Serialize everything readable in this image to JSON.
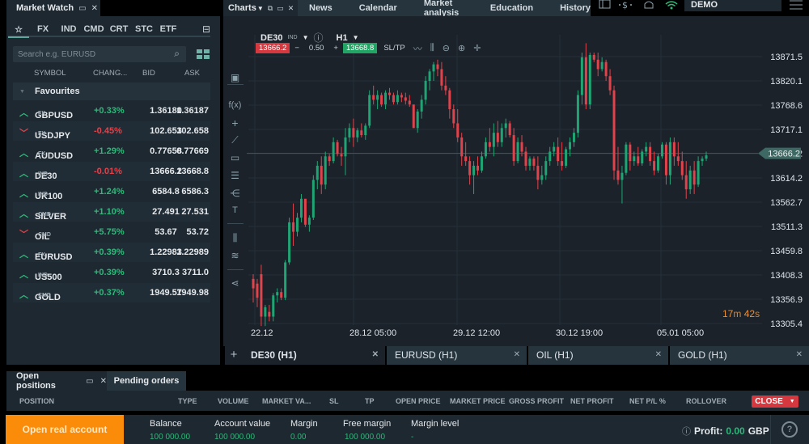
{
  "market_watch": {
    "title": "Market Watch",
    "tabs": [
      "☆",
      "FX",
      "IND",
      "CMD",
      "CRT",
      "STC",
      "ETF"
    ],
    "search_placeholder": "Search e.g. EURUSD",
    "columns": {
      "symbol": "SYMBOL",
      "change": "CHANG...",
      "bid": "BID",
      "ask": "ASK"
    },
    "group": "Favourites",
    "rows": [
      {
        "dir": "up",
        "symbol": "GBPUSD",
        "cls": "FX",
        "change": "+0.33%",
        "chg_dir": "up",
        "bid": "1.36180",
        "ask": "1.36187"
      },
      {
        "dir": "down",
        "symbol": "USDJPY",
        "cls": "FX",
        "change": "-0.45%",
        "chg_dir": "down",
        "bid": "102.653",
        "ask": "102.658"
      },
      {
        "dir": "up",
        "symbol": "AUDUSD",
        "cls": "FX",
        "change": "+1.29%",
        "chg_dir": "up",
        "bid": "0.77658",
        "ask": "0.77669"
      },
      {
        "dir": "up",
        "symbol": "DE30",
        "cls": "IND",
        "change": "-0.01%",
        "chg_dir": "down",
        "bid": "13666.2",
        "ask": "13668.8"
      },
      {
        "dir": "up",
        "symbol": "UK100",
        "cls": "IND",
        "change": "+1.24%",
        "chg_dir": "up",
        "bid": "6584.8",
        "ask": "6586.3"
      },
      {
        "dir": "up",
        "symbol": "SILVER",
        "cls": "CMD",
        "change": "+1.10%",
        "chg_dir": "up",
        "bid": "27.491",
        "ask": "27.531"
      },
      {
        "dir": "down",
        "symbol": "OIL",
        "cls": "CMD",
        "change": "+5.75%",
        "chg_dir": "up",
        "bid": "53.67",
        "ask": "53.72"
      },
      {
        "dir": "up",
        "symbol": "EURUSD",
        "cls": "FX",
        "change": "+0.39%",
        "chg_dir": "up",
        "bid": "1.22983",
        "ask": "1.22989"
      },
      {
        "dir": "up",
        "symbol": "US500",
        "cls": "IND",
        "change": "+0.39%",
        "chg_dir": "up",
        "bid": "3710.3",
        "ask": "3711.0"
      },
      {
        "dir": "up",
        "symbol": "GOLD",
        "cls": "CMD",
        "change": "+0.37%",
        "chg_dir": "up",
        "bid": "1949.57",
        "ask": "1949.98"
      }
    ]
  },
  "nav": {
    "charts_label": "Charts",
    "items": [
      "News",
      "Calendar",
      "Market analysis",
      "Education",
      "History"
    ],
    "account_mode": "DEMO"
  },
  "chart": {
    "symbol": "DE30",
    "symbol_class": "IND",
    "timeframe": "H1",
    "sell_price": "13666.2",
    "volume": "0.50",
    "buy_price": "13668.8",
    "sltp_label": "SL/TP",
    "current_price_label": "13666.2",
    "countdown": {
      "min": "17",
      "min_unit": "m",
      "sec": "42",
      "sec_unit": "s"
    },
    "tabs": [
      {
        "label": "DE30 (H1)",
        "active": true
      },
      {
        "label": "EURUSD (H1)",
        "active": false
      },
      {
        "label": "OIL (H1)",
        "active": false
      },
      {
        "label": "GOLD (H1)",
        "active": false
      }
    ]
  },
  "chart_data": {
    "type": "candlestick",
    "title": "DE30 H1",
    "xlabel": "",
    "ylabel": "",
    "ylim": [
      13280,
      13900
    ],
    "y_ticks": [
      "13871.5",
      "13820.1",
      "13768.6",
      "13717.1",
      "13666.2",
      "13614.2",
      "13562.7",
      "13511.3",
      "13459.8",
      "13408.3",
      "13356.9",
      "13305.4"
    ],
    "x_ticks": [
      "22.12",
      "28.12 05:00",
      "29.12 12:00",
      "30.12 19:00",
      "05.01 05:00"
    ],
    "current_price": 13666.2,
    "ohlc": [
      [
        13400,
        13410,
        13350,
        13380
      ],
      [
        13390,
        13400,
        13340,
        13360
      ],
      [
        13410,
        13430,
        13300,
        13320
      ],
      [
        13320,
        13345,
        13300,
        13340
      ],
      [
        13330,
        13345,
        13310,
        13320
      ],
      [
        13320,
        13370,
        13310,
        13365
      ],
      [
        13365,
        13380,
        13350,
        13372
      ],
      [
        13372,
        13380,
        13355,
        13360
      ],
      [
        13360,
        13440,
        13355,
        13435
      ],
      [
        13435,
        13530,
        13430,
        13520
      ],
      [
        13520,
        13560,
        13470,
        13500
      ],
      [
        13500,
        13540,
        13490,
        13530
      ],
      [
        13530,
        13580,
        13520,
        13570
      ],
      [
        13570,
        13560,
        13510,
        13515
      ],
      [
        13515,
        13535,
        13500,
        13530
      ],
      [
        13530,
        13620,
        13525,
        13610
      ],
      [
        13610,
        13650,
        13590,
        13640
      ],
      [
        13640,
        13660,
        13580,
        13600
      ],
      [
        13600,
        13670,
        13590,
        13660
      ],
      [
        13660,
        13665,
        13640,
        13650
      ],
      [
        13650,
        13700,
        13645,
        13690
      ],
      [
        13690,
        13695,
        13660,
        13665
      ],
      [
        13665,
        13680,
        13640,
        13660
      ],
      [
        13660,
        13720,
        13620,
        13700
      ],
      [
        13700,
        13730,
        13690,
        13720
      ],
      [
        13720,
        13740,
        13680,
        13700
      ],
      [
        13700,
        13720,
        13690,
        13715
      ],
      [
        13715,
        13730,
        13700,
        13705
      ],
      [
        13705,
        13730,
        13695,
        13725
      ],
      [
        13725,
        13800,
        13720,
        13790
      ],
      [
        13790,
        13810,
        13770,
        13780
      ],
      [
        13780,
        13800,
        13760,
        13790
      ],
      [
        13790,
        13795,
        13765,
        13770
      ],
      [
        13770,
        13800,
        13760,
        13795
      ],
      [
        13795,
        13805,
        13780,
        13790
      ],
      [
        13790,
        13795,
        13770,
        13775
      ],
      [
        13775,
        13800,
        13770,
        13790
      ],
      [
        13790,
        13795,
        13775,
        13785
      ],
      [
        13785,
        13795,
        13770,
        13778
      ],
      [
        13778,
        13790,
        13765,
        13770
      ],
      [
        13770,
        13730,
        13720,
        13720
      ],
      [
        13720,
        13760,
        13710,
        13755
      ],
      [
        13755,
        13790,
        13740,
        13780
      ],
      [
        13780,
        13830,
        13770,
        13820
      ],
      [
        13820,
        13845,
        13800,
        13840
      ],
      [
        13840,
        13860,
        13820,
        13855
      ],
      [
        13855,
        13865,
        13830,
        13845
      ],
      [
        13845,
        13860,
        13800,
        13810
      ],
      [
        13810,
        13830,
        13790,
        13800
      ],
      [
        13800,
        13805,
        13740,
        13760
      ],
      [
        13760,
        13770,
        13720,
        13730
      ],
      [
        13730,
        13760,
        13690,
        13700
      ],
      [
        13700,
        13710,
        13640,
        13660
      ],
      [
        13660,
        13690,
        13640,
        13650
      ],
      [
        13650,
        13660,
        13600,
        13620
      ],
      [
        13620,
        13650,
        13580,
        13640
      ],
      [
        13640,
        13660,
        13620,
        13630
      ],
      [
        13630,
        13670,
        13625,
        13660
      ],
      [
        13660,
        13700,
        13655,
        13690
      ],
      [
        13690,
        13720,
        13670,
        13680
      ],
      [
        13680,
        13730,
        13660,
        13710
      ],
      [
        13710,
        13735,
        13680,
        13690
      ],
      [
        13690,
        13730,
        13680,
        13720
      ],
      [
        13720,
        13740,
        13700,
        13730
      ],
      [
        13730,
        13735,
        13700,
        13705
      ],
      [
        13705,
        13720,
        13640,
        13650
      ],
      [
        13650,
        13700,
        13645,
        13690
      ],
      [
        13690,
        13705,
        13660,
        13670
      ],
      [
        13670,
        13680,
        13630,
        13640
      ],
      [
        13640,
        13660,
        13630,
        13655
      ],
      [
        13655,
        13660,
        13630,
        13640
      ],
      [
        13640,
        13660,
        13590,
        13610
      ],
      [
        13610,
        13640,
        13600,
        13620
      ],
      [
        13620,
        13660,
        13610,
        13650
      ],
      [
        13650,
        13680,
        13640,
        13670
      ],
      [
        13670,
        13690,
        13660,
        13680
      ],
      [
        13680,
        13700,
        13640,
        13650
      ],
      [
        13650,
        13690,
        13630,
        13640
      ],
      [
        13640,
        13680,
        13635,
        13675
      ],
      [
        13675,
        13700,
        13660,
        13690
      ],
      [
        13690,
        13720,
        13680,
        13710
      ],
      [
        13710,
        13800,
        13700,
        13790
      ],
      [
        13790,
        13880,
        13770,
        13870
      ],
      [
        13870,
        13900,
        13760,
        13770
      ],
      [
        13770,
        13880,
        13760,
        13875
      ],
      [
        13875,
        13880,
        13860,
        13865
      ],
      [
        13865,
        13880,
        13830,
        13845
      ],
      [
        13845,
        13870,
        13840,
        13860
      ],
      [
        13860,
        13865,
        13820,
        13830
      ],
      [
        13830,
        13845,
        13790,
        13800
      ],
      [
        13800,
        13810,
        13610,
        13630
      ],
      [
        13630,
        13680,
        13600,
        13610
      ],
      [
        13610,
        13640,
        13560,
        13625
      ],
      [
        13625,
        13690,
        13620,
        13685
      ],
      [
        13685,
        13690,
        13630,
        13650
      ],
      [
        13650,
        13670,
        13640,
        13660
      ],
      [
        13660,
        13680,
        13640,
        13645
      ],
      [
        13645,
        13675,
        13640,
        13670
      ],
      [
        13670,
        13690,
        13660,
        13680
      ],
      [
        13680,
        13690,
        13640,
        13650
      ],
      [
        13650,
        13670,
        13620,
        13630
      ],
      [
        13630,
        13665,
        13625,
        13660
      ],
      [
        13660,
        13690,
        13655,
        13685
      ],
      [
        13685,
        13690,
        13600,
        13620
      ],
      [
        13620,
        13700,
        13600,
        13690
      ],
      [
        13690,
        13700,
        13640,
        13660
      ],
      [
        13660,
        13690,
        13640,
        13650
      ],
      [
        13650,
        13670,
        13610,
        13620
      ],
      [
        13620,
        13650,
        13570,
        13590
      ],
      [
        13590,
        13640,
        13580,
        13630
      ],
      [
        13630,
        13650,
        13580,
        13600
      ],
      [
        13600,
        13660,
        13595,
        13650
      ],
      [
        13650,
        13660,
        13640,
        13655
      ],
      [
        13655,
        13670,
        13650,
        13662
      ]
    ],
    "colors": {
      "up": "#1fa574",
      "down": "#e0434b"
    }
  },
  "positions": {
    "tab_open": "Open positions",
    "tab_pending": "Pending orders",
    "columns": [
      "POSITION",
      "TYPE",
      "VOLUME",
      "MARKET VA...",
      "SL",
      "TP",
      "OPEN PRICE",
      "MARKET PRICE",
      "GROSS PROFIT",
      "NET PROFIT",
      "NET P/L %",
      "ROLLOVER"
    ],
    "close_label": "CLOSE"
  },
  "account": {
    "open_real": "Open real account",
    "fields": [
      {
        "label": "Balance",
        "value": "100 000.00"
      },
      {
        "label": "Account value",
        "value": "100 000.00"
      },
      {
        "label": "Margin",
        "value": "0.00"
      },
      {
        "label": "Free margin",
        "value": "100 000.00"
      },
      {
        "label": "Margin level",
        "value": "-"
      }
    ],
    "profit_label": "Profit:",
    "profit_value": "0.00",
    "currency": "GBP"
  }
}
